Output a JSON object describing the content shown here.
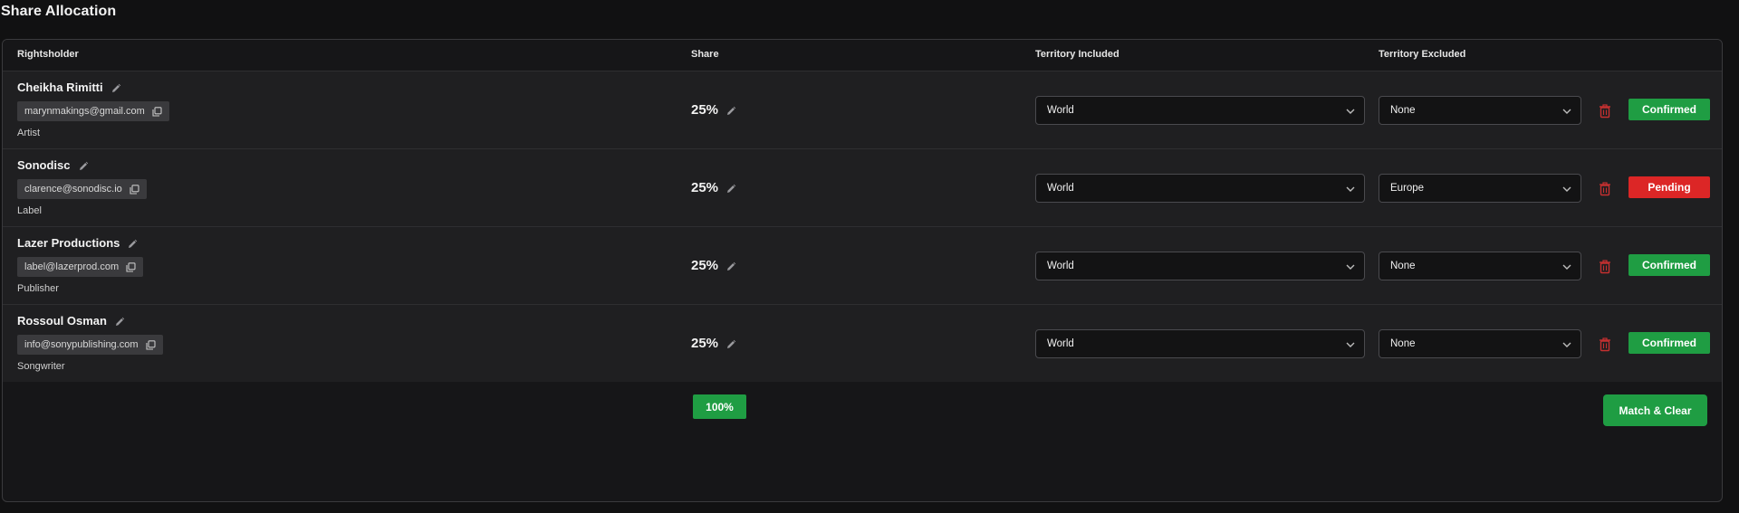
{
  "section": {
    "title": "Share Allocation"
  },
  "columns": {
    "rightsholder": "Rightsholder",
    "share": "Share",
    "territory_included": "Territory Included",
    "territory_excluded": "Territory Excluded"
  },
  "rows": [
    {
      "name": "Cheikha Rimitti",
      "email": "marynmakings@gmail.com",
      "role": "Artist",
      "share": "25%",
      "territory_included": "World",
      "territory_excluded": "None",
      "status": "Confirmed",
      "status_color": "#1f9d43"
    },
    {
      "name": "Sonodisc",
      "email": "clarence@sonodisc.io",
      "role": "Label",
      "share": "25%",
      "territory_included": "World",
      "territory_excluded": "Europe",
      "status": "Pending",
      "status_color": "#dc2626"
    },
    {
      "name": "Lazer Productions",
      "email": "label@lazerprod.com",
      "role": "Publisher",
      "share": "25%",
      "territory_included": "World",
      "territory_excluded": "None",
      "status": "Confirmed",
      "status_color": "#1f9d43"
    },
    {
      "name": "Rossoul Osman",
      "email": "info@sonypublishing.com",
      "role": "Songwriter",
      "share": "25%",
      "territory_included": "World",
      "territory_excluded": "None",
      "status": "Confirmed",
      "status_color": "#1f9d43"
    }
  ],
  "footer": {
    "total": "100%",
    "match_button": "Match & Clear"
  },
  "colors": {
    "accent_green": "#1f9d43",
    "danger_red": "#dc2626",
    "trash_red": "#c53030"
  },
  "icons": {
    "edit": "pencil-icon",
    "copy": "copy-icon",
    "dropdown": "chevron-down-icon",
    "delete": "trash-icon"
  }
}
